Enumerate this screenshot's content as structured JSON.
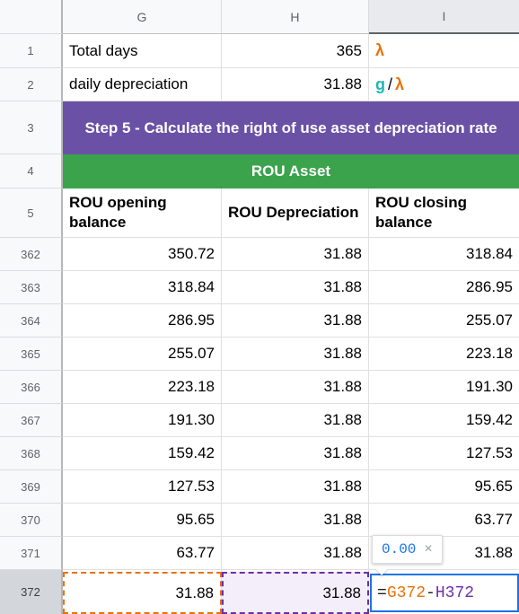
{
  "columns": [
    {
      "label": "G",
      "selected": false
    },
    {
      "label": "H",
      "selected": false
    },
    {
      "label": "I",
      "selected": true
    }
  ],
  "top_rows": [
    {
      "num": "1",
      "g": "Total days",
      "h": "365",
      "i_symbols": [
        "λ"
      ]
    },
    {
      "num": "2",
      "g": "daily depreciation",
      "h": "31.88",
      "i_symbols": [
        "g",
        "/",
        "λ"
      ]
    }
  ],
  "banners": [
    {
      "num": "3",
      "text": "Step 5 - Calculate the right of use asset depreciation rate",
      "color": "#6a51a6"
    },
    {
      "num": "4",
      "text": "ROU Asset",
      "color": "#3aa34c"
    }
  ],
  "header_row": {
    "num": "5",
    "cells": [
      "ROU opening balance",
      "ROU Depreciation",
      "ROU closing balance"
    ]
  },
  "data_rows": [
    {
      "num": "362",
      "opening": "350.72",
      "depreciation": "31.88",
      "closing": "318.84"
    },
    {
      "num": "363",
      "opening": "318.84",
      "depreciation": "31.88",
      "closing": "286.95"
    },
    {
      "num": "364",
      "opening": "286.95",
      "depreciation": "31.88",
      "closing": "255.07"
    },
    {
      "num": "365",
      "opening": "255.07",
      "depreciation": "31.88",
      "closing": "223.18"
    },
    {
      "num": "366",
      "opening": "223.18",
      "depreciation": "31.88",
      "closing": "191.30"
    },
    {
      "num": "367",
      "opening": "191.30",
      "depreciation": "31.88",
      "closing": "159.42"
    },
    {
      "num": "368",
      "opening": "159.42",
      "depreciation": "31.88",
      "closing": "127.53"
    },
    {
      "num": "369",
      "opening": "127.53",
      "depreciation": "31.88",
      "closing": "95.65"
    },
    {
      "num": "370",
      "opening": "95.65",
      "depreciation": "31.88",
      "closing": "63.77"
    },
    {
      "num": "371",
      "opening": "63.77",
      "depreciation": "31.88",
      "closing": "31.88"
    }
  ],
  "active_row": {
    "num": "372",
    "opening": "31.88",
    "depreciation": "31.88"
  },
  "formula": {
    "equals": "=",
    "ref1": "G372",
    "operator": "-",
    "ref2": "H372"
  },
  "result_tooltip": {
    "value": "0.00",
    "close": "×"
  },
  "colors": {
    "banner_purple": "#6a51a6",
    "banner_green": "#3aa34c",
    "ref_orange": "#e8710a",
    "ref_purple": "#6f2da8",
    "editor_blue": "#1a73e8",
    "symbol_teal": "#21b5b5"
  }
}
